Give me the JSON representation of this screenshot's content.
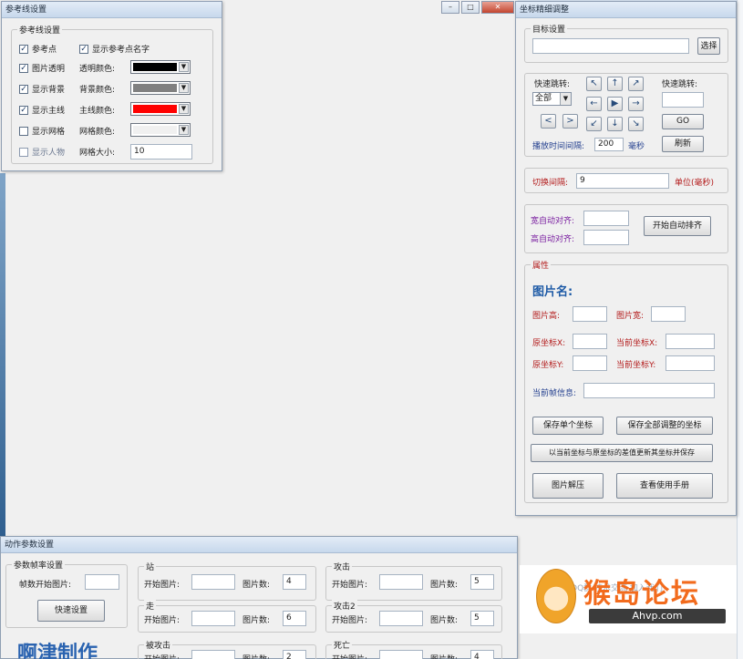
{
  "ref_window": {
    "title": "参考线设置",
    "group": "参考线设置",
    "show_ref_point": "参考点",
    "show_ref_name": "显示参考点名字",
    "transparent_image": "图片透明",
    "show_background": "显示背景",
    "show_main_line": "显示主线",
    "show_grid": "显示网格",
    "show_crosshair": "显示人物",
    "transparent_color_label": "透明颜色:",
    "bg_color_label": "背景颜色:",
    "main_line_color_label": "主线颜色:",
    "grid_color_label": "网格颜色:",
    "grid_size_label": "网格大小:",
    "grid_size_value": "10",
    "colors": {
      "transparent": "#000000",
      "background": "#808080",
      "main_line": "#ff0000",
      "grid": "#f0f0f0"
    }
  },
  "coord_window": {
    "title": "坐标精细调整",
    "target_group": "目标设置",
    "target_value": "",
    "select_btn": "选择",
    "fast_jump_label": "快速跳转:",
    "fast_jump_select": "全部",
    "quick_jump_label": "快速跳转:",
    "quick_jump_value": "",
    "go_btn": "GO",
    "play_interval_label": "播放时间间隔:",
    "play_interval_value": "200",
    "ms_unit": "毫秒",
    "refresh_btn": "刷新",
    "arrows": [
      "↖",
      "↑",
      "↗",
      "←",
      "▶",
      "→",
      "↙",
      "↓",
      "↘"
    ],
    "prev_btn": "<",
    "next_btn": ">",
    "switch_interval_label": "切换间隔:",
    "switch_interval_value": "9",
    "switch_unit": "单位(毫秒)",
    "width_align_label": "宽自动对齐:",
    "height_align_label": "高自动对齐:",
    "auto_align_btn": "开始自动排齐",
    "image_group": "属性",
    "image_name": "图片名:",
    "img_height_label": "图片高:",
    "img_width_label": "图片宽:",
    "orig_x_label": "原坐标X:",
    "cur_x_label": "当前坐标X:",
    "orig_y_label": "原坐标Y:",
    "cur_y_label": "当前坐标Y:",
    "cur_info_label": "当前帧信息:",
    "save_single_btn": "保存单个坐标",
    "save_all_btn": "保存全部调整的坐标",
    "apply_btn": "以当前坐标与原坐标的差值更新其坐标并保存",
    "unpack_btn": "图片解压",
    "manual_btn": "查看使用手册"
  },
  "action_window": {
    "title": "动作参数设置",
    "frame_group": "参数帧率设置",
    "frame_start_label": "帧数开始图片:",
    "frame_start_value": "",
    "quick_btn": "快速设置",
    "stand_group": "站",
    "walk_group": "走",
    "hurt_group": "被攻击",
    "attack1_group": "攻击",
    "attack2_group": "攻击2",
    "death_group": "死亡",
    "start_img_label": "开始图片:",
    "img_count_label": "图片数:",
    "stand_count": "4",
    "walk_count": "6",
    "hurt_count": "2",
    "attack1_count": "5",
    "attack2_count": "5",
    "death_count": "4",
    "author": "啊津制作"
  },
  "logo": {
    "site_text": "QQ群 技术交流 加入我们",
    "title": "猴岛论坛",
    "subtitle": "Ahvp.com"
  }
}
